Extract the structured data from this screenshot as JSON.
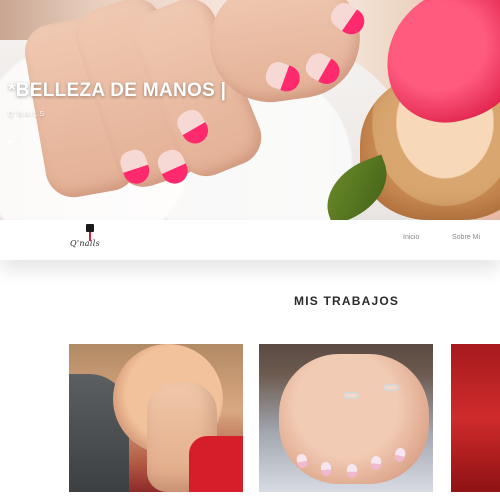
{
  "hero": {
    "title": "*BELLEZA DE MANOS |",
    "subtitle": "Q'NAILS",
    "social_icons": [
      {
        "icon": "email-icon",
        "glyph": "■"
      },
      {
        "icon": "whatsapp-icon",
        "glyph": "◔"
      }
    ]
  },
  "navbar": {
    "logo_text": "Q'nails",
    "links": [
      "Inicio",
      "Sobre Mi"
    ]
  },
  "section": {
    "title": "MIS TRABAJOS"
  }
}
